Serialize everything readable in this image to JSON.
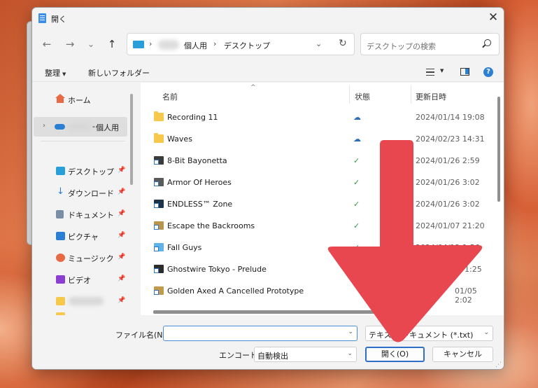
{
  "window": {
    "title": "開く",
    "close_glyph": "✕"
  },
  "navigation": {
    "back_glyph": "←",
    "forward_glyph": "→",
    "recent_glyph": "⌄",
    "up_glyph": "↑",
    "address": {
      "separator": "›",
      "segments": [
        "個人用",
        "デスクトップ"
      ],
      "dropdown_glyph": "⌄",
      "refresh_glyph": "↻"
    },
    "search_placeholder": "デスクトップの検索"
  },
  "toolbar": {
    "organize": "整理",
    "organize_caret": "▼",
    "new_folder": "新しいフォルダー",
    "view_caret": "▼",
    "help": "?"
  },
  "sidebar": {
    "home": "ホーム",
    "onedrive": "個人用",
    "onedrive_prefix": "-",
    "expand_glyph": "›",
    "pin_glyph": "📌",
    "quick_access": [
      {
        "label": "デスクトップ",
        "icon": "desktop-icon",
        "color": "#2a9ed9"
      },
      {
        "label": "ダウンロード",
        "icon": "download-icon",
        "color": "#2a7fd4"
      },
      {
        "label": "ドキュメント",
        "icon": "documents-icon",
        "color": "#7a8fa6"
      },
      {
        "label": "ピクチャ",
        "icon": "pictures-icon",
        "color": "#2a7fd4"
      },
      {
        "label": "ミュージック",
        "icon": "music-icon",
        "color": "#e86a44"
      },
      {
        "label": "ビデオ",
        "icon": "videos-icon",
        "color": "#8a3fd1"
      }
    ]
  },
  "file_list": {
    "columns": {
      "name": "名前",
      "status": "状態",
      "modified": "更新日時"
    },
    "sort_glyph": "^",
    "rows": [
      {
        "name": "Recording 11",
        "type": "folder",
        "status": "cloud",
        "status_glyph": "☁",
        "date": "2024/01/14 19:08"
      },
      {
        "name": "Waves",
        "type": "folder",
        "status": "cloud",
        "status_glyph": "☁",
        "date": "2024/02/23 14:31"
      },
      {
        "name": "8-Bit Bayonetta",
        "type": "game",
        "status": "synced",
        "status_glyph": "✓",
        "date": "2024/01/26 2:59"
      },
      {
        "name": "Armor Of Heroes",
        "type": "game",
        "status": "synced",
        "status_glyph": "✓",
        "date": "2024/01/26 3:02"
      },
      {
        "name": "ENDLESS™ Zone",
        "type": "game",
        "status": "synced",
        "status_glyph": "✓",
        "date": "2024/01/26 3:02"
      },
      {
        "name": "Escape the Backrooms",
        "type": "game",
        "status": "synced",
        "status_glyph": "✓",
        "date": "2024/01/07 21:20"
      },
      {
        "name": "Fall Guys",
        "type": "game",
        "status": "synced",
        "status_glyph": "✓",
        "date": "2024/04/12 1:56"
      },
      {
        "name": "Ghostwire Tokyo - Prelude",
        "type": "game",
        "status": "",
        "status_glyph": "",
        "date": "1:25"
      },
      {
        "name": "Golden Axed A Cancelled Prototype",
        "type": "game",
        "status": "",
        "status_glyph": "",
        "date": "01/05 2:02"
      }
    ]
  },
  "footer": {
    "filename_label": "ファイル名(N):",
    "filename_value": "",
    "filetype": "テキスト ドキュメント (*.txt)",
    "encoding_label": "エンコード:",
    "encoding_value": "自動検出",
    "open_button": "開く(O)",
    "cancel_button": "キャンセル",
    "dropdown_glyph": "⌄",
    "grip_glyph": "⋰"
  },
  "colors": {
    "accent": "#2f6fc7",
    "annotation_arrow": "#e8474f",
    "synced": "#2e9a4a",
    "cloud": "#2a6fb8"
  }
}
